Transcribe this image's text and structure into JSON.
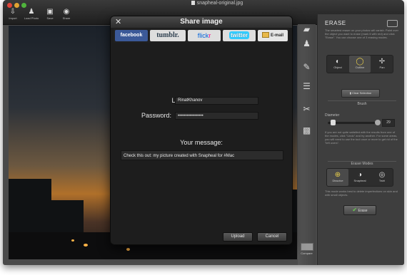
{
  "window": {
    "title": "snapheal-original.jpg",
    "toolbar": [
      {
        "label": "Import",
        "icon": "import-icon"
      },
      {
        "label": "Load Photo",
        "icon": "load-photo-icon"
      },
      {
        "label": "Save",
        "icon": "save-icon"
      },
      {
        "label": "Share",
        "icon": "share-icon"
      }
    ]
  },
  "dialog": {
    "title": "Share image",
    "tabs": {
      "facebook": "facebook",
      "tumblr": "tumblr.",
      "flickr_part1": "flick",
      "flickr_part2": "r",
      "twitter": "twitter",
      "email": "E-mail"
    },
    "login_label": "Login:",
    "login_value": "RinatKhanov",
    "password_label": "Password:",
    "password_value": "•••••••••••••••••",
    "message_label": "Your message:",
    "message_value": "Check this out: my picture created with Snapheal for #Mac",
    "upload_label": "Upload",
    "cancel_label": "Cancel"
  },
  "side_panel": {
    "title": "ERASE",
    "description": "The smartest eraser on your photos will vanish. Paint over the object you want to erase (mark it with red) and click \"Erase\". You can choose one of 3 erasing modes.",
    "selection_modes": [
      {
        "label": "Object",
        "icon": "object-icon"
      },
      {
        "label": "Outline",
        "icon": "outline-icon"
      },
      {
        "label": "Pan",
        "icon": "pan-icon"
      }
    ],
    "clear_selection_label": "Clear Selection",
    "brush_header": "Brush",
    "diameter_label": "Diameter",
    "diameter_value": "29",
    "hint_text": "If you are not quite satisfied with the results from one of the modes, click \"Undo\" and try another. For some areas, you will need to use the tool once or more to get rid of the \"left overs\".",
    "eraser_modes_header": "Eraser Modes",
    "eraser_modes": [
      {
        "label": "Dissolve",
        "icon": "dissolve-icon"
      },
      {
        "label": "Snapheal",
        "icon": "snapheal-icon"
      },
      {
        "label": "Twirl",
        "icon": "twirl-icon"
      }
    ],
    "mode_hint": "This mode works best to delete imperfections on skin and with small objects.",
    "erase_label": "Erase"
  },
  "right_strip": {
    "tools": [
      "erase-tool-icon",
      "stamp-tool-icon",
      "brush-tool-icon",
      "adjust-tool-icon",
      "cut-tool-icon",
      "crop-tool-icon"
    ],
    "compare_label": "Compare"
  },
  "colors": {
    "facebook": "#3b5998",
    "twitter": "#33ccff",
    "accent_active": "#e9cf4a",
    "erase_check": "#68c850"
  }
}
